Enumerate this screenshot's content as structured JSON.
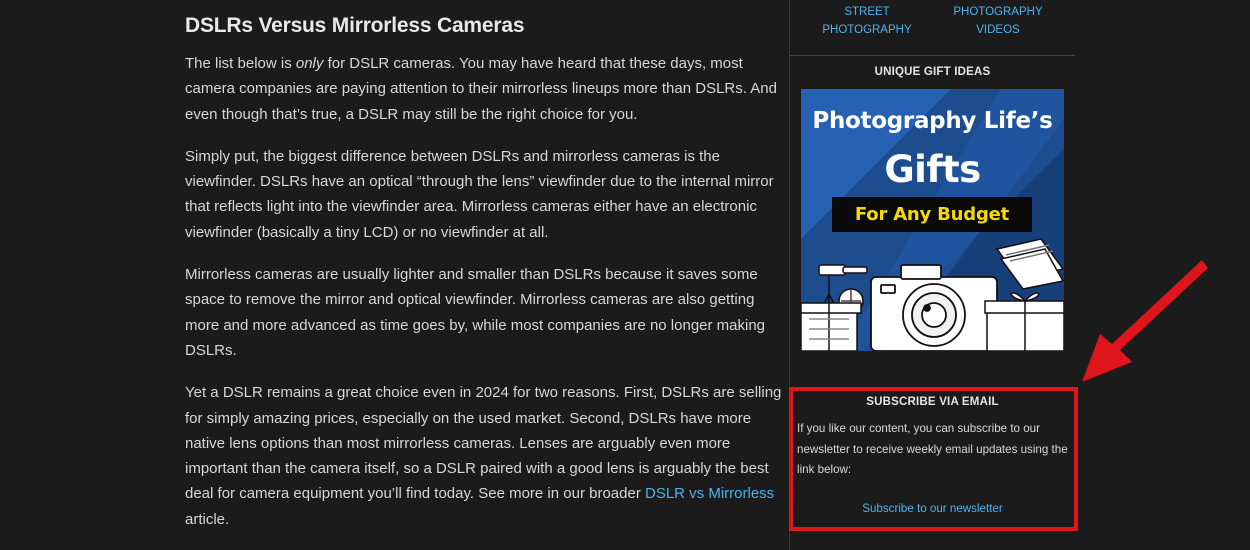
{
  "article": {
    "heading": "DSLRs Versus Mirrorless Cameras",
    "p1": {
      "before": "The list below is ",
      "emphasis": "only",
      "after": " for DSLR cameras. You may have heard that these days, most camera companies are paying attention to their mirrorless lineups more than DSLRs. And even though that’s true, a DSLR may still be the right choice for you."
    },
    "p2": "Simply put, the biggest difference between DSLRs and mirrorless cameras is the viewfinder. DSLRs have an optical “through the lens” viewfinder due to the internal mirror that reflects light into the viewfinder area. Mirrorless cameras either have an electronic viewfinder (basically a tiny LCD) or no viewfinder at all.",
    "p3": "Mirrorless cameras are usually lighter and smaller than DSLRs because it saves some space to remove the mirror and optical viewfinder. Mirrorless cameras are also getting more and more advanced as time goes by, while most companies are no longer making DSLRs.",
    "p4": {
      "before": "Yet a DSLR remains a great choice even in 2024 for two reasons. First, DSLRs are selling for simply amazing prices, especially on the used market. Second, DSLRs have more native lens options than most mirrorless cameras. Lenses are arguably even more important than the camera itself, so a DSLR paired with a good lens is arguably the best deal for camera equipment you’ll find today. See more in our broader ",
      "link": "DSLR vs Mirrorless",
      "after": " article."
    }
  },
  "sidebar": {
    "categories": [
      {
        "label": "STREET\nPHOTOGRAPHY"
      },
      {
        "label": "PHOTOGRAPHY\nVIDEOS"
      }
    ],
    "gifts": {
      "title": "UNIQUE GIFT IDEAS",
      "banner_line1": "Photography Life’s",
      "banner_line2": "Gifts",
      "banner_pill": "For Any Budget"
    },
    "subscribe": {
      "title": "SUBSCRIBE VIA EMAIL",
      "text": "If you like our content, you can subscribe to our newsletter to receive weekly email updates using the link below:",
      "link": "Subscribe to our newsletter"
    }
  },
  "colors": {
    "background": "#1b1b1b",
    "link": "#4fb2ec",
    "highlight_red": "#e0141b",
    "banner_blue": "#1f4f93",
    "banner_yellow": "#f5d90a"
  },
  "icons": [
    "red-arrow-icon",
    "tripod-illustration",
    "camera-illustration",
    "gift-box-illustration"
  ]
}
